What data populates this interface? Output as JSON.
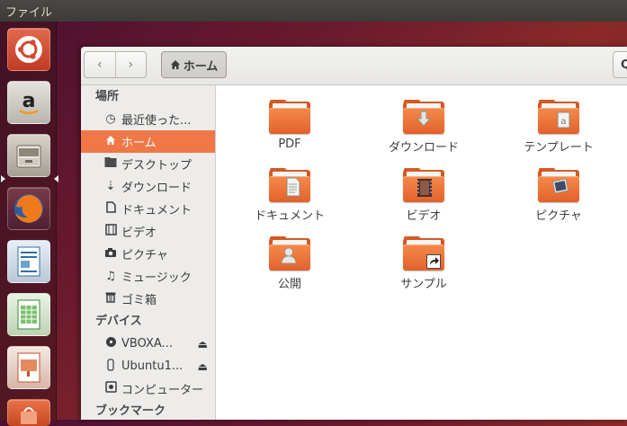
{
  "top_panel": {
    "title": "ファイル"
  },
  "launcher": {
    "items": [
      {
        "name": "ubuntu-dash",
        "color": "#d5462f"
      },
      {
        "name": "amazon",
        "color": "#c9c6c0"
      },
      {
        "name": "files",
        "color": "#b8b2a6"
      },
      {
        "name": "firefox",
        "color": "#e0621f"
      },
      {
        "name": "libreoffice-writer",
        "color": "#2f6fa7"
      },
      {
        "name": "libreoffice-calc",
        "color": "#3b8a33"
      },
      {
        "name": "libreoffice-impress",
        "color": "#c4502a"
      },
      {
        "name": "software-center",
        "color": "#d7522a"
      }
    ]
  },
  "toolbar": {
    "back_symbol": "‹",
    "forward_symbol": "›",
    "path_label": "ホーム",
    "search_symbol": "Q"
  },
  "sidebar": {
    "places_header": "場所",
    "places": [
      {
        "label": "最近使った...",
        "icon": "clock-icon"
      },
      {
        "label": "ホーム",
        "icon": "home-icon",
        "active": true
      },
      {
        "label": "デスクトップ",
        "icon": "desktop-icon"
      },
      {
        "label": "ダウンロード",
        "icon": "download-icon"
      },
      {
        "label": "ドキュメント",
        "icon": "document-icon"
      },
      {
        "label": "ビデオ",
        "icon": "video-icon"
      },
      {
        "label": "ピクチャ",
        "icon": "camera-icon"
      },
      {
        "label": "ミュージック",
        "icon": "music-icon"
      },
      {
        "label": "ゴミ箱",
        "icon": "trash-icon"
      }
    ],
    "devices_header": "デバイス",
    "devices": [
      {
        "label": "VBOXA...",
        "icon": "disc-icon",
        "eject": true
      },
      {
        "label": "Ubuntu1...",
        "icon": "usb-drive-icon",
        "eject": true
      },
      {
        "label": "コンピューター",
        "icon": "computer-icon"
      }
    ],
    "bookmarks_header": "ブックマーク"
  },
  "files": [
    {
      "label": "PDF",
      "emblem": "none"
    },
    {
      "label": "ダウンロード",
      "emblem": "download-arrow"
    },
    {
      "label": "テンプレート",
      "emblem": "template"
    },
    {
      "label": "ドキュメント",
      "emblem": "document"
    },
    {
      "label": "ビデオ",
      "emblem": "film"
    },
    {
      "label": "ピクチャ",
      "emblem": "picture"
    },
    {
      "label": "公開",
      "emblem": "person"
    },
    {
      "label": "サンプル",
      "emblem": "link-arrow"
    }
  ],
  "colors": {
    "accent": "#f07746",
    "folder": "#e86f35"
  }
}
